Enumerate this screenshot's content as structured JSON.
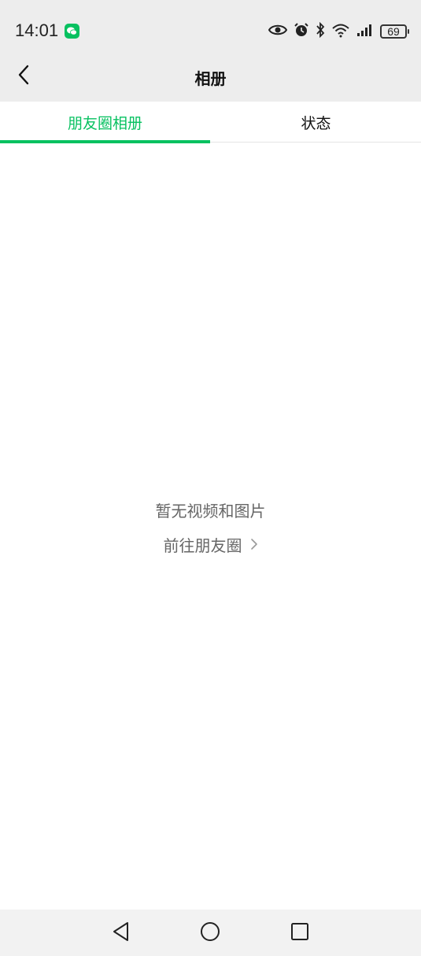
{
  "status_bar": {
    "time": "14:01",
    "battery_level": "69",
    "icons": [
      "wechat-icon",
      "eye-icon",
      "alarm-icon",
      "bluetooth-icon",
      "wifi-icon",
      "signal-icon",
      "battery-icon"
    ]
  },
  "nav": {
    "title": "相册",
    "back_icon": "chevron-left-icon"
  },
  "tabs": [
    {
      "label": "朋友圈相册",
      "active": true
    },
    {
      "label": "状态",
      "active": false
    }
  ],
  "empty_state": {
    "message": "暂无视频和图片",
    "link_label": "前往朋友圈",
    "link_icon": "chevron-right-icon"
  },
  "system_nav": {
    "buttons": [
      "back-triangle-icon",
      "home-circle-icon",
      "recents-square-icon"
    ]
  },
  "colors": {
    "accent": "#07c160",
    "header_bg": "#ededed",
    "muted_text": "#666666"
  }
}
